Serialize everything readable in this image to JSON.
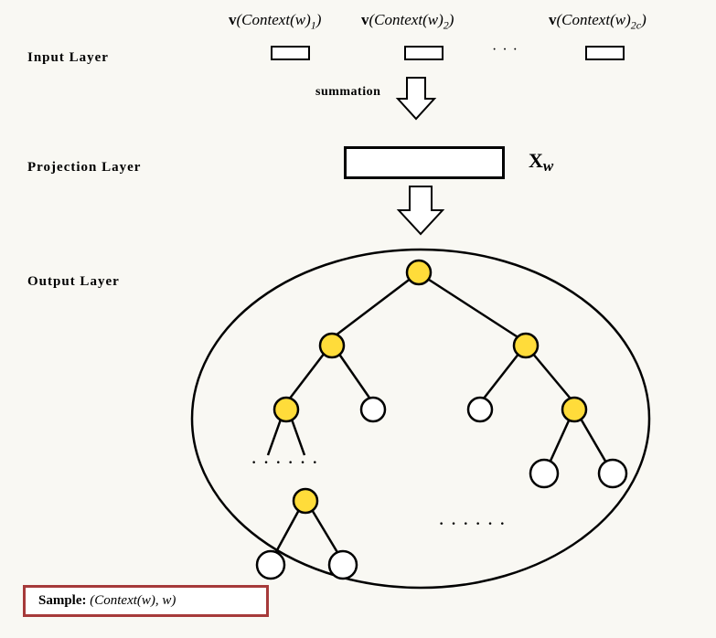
{
  "layers": {
    "input": "Input Layer",
    "projection": "Projection Layer",
    "output": "Output Layer"
  },
  "input_vectors": {
    "v1": "v(Context(w)₁)",
    "v2": "v(Context(w)₂)",
    "vlast": "v(Context(w)₂c)",
    "ellipsis": "···"
  },
  "summation": "summation",
  "projection_symbol": "X",
  "projection_sub": "w",
  "tree_dots1": "······",
  "tree_dots2": "······",
  "sample": {
    "label": "Sample:",
    "expr": "(Context(w), w)"
  }
}
